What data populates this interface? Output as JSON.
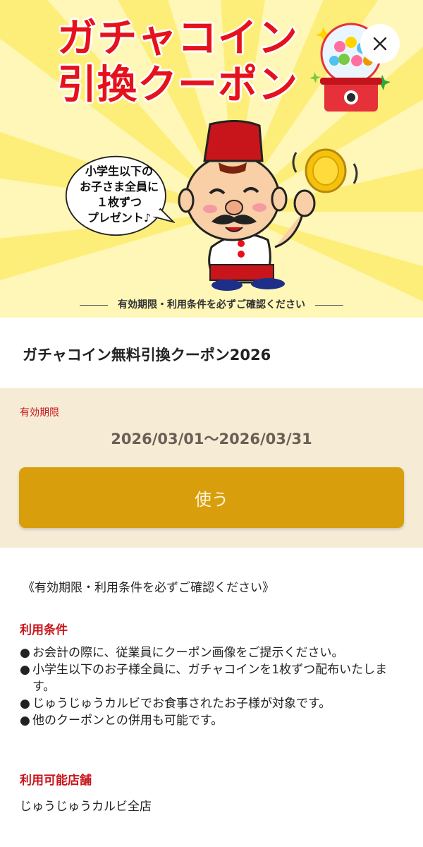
{
  "banner": {
    "title_line1": "ガチャコイン",
    "title_line2": "引換クーポン",
    "bubble_lines": [
      "小学生以下の",
      "お子さま全員に",
      "１枚ずつ",
      "プレゼント♪"
    ],
    "footer_text": "有効期限・利用条件を必ずご確認ください",
    "colors": {
      "title": "#e5121c",
      "background": "#fff7b8",
      "ray": "#fdee7a"
    }
  },
  "close_icon": "close-icon",
  "coupon": {
    "title": "ガチャコイン無料引換クーポン2026",
    "validity_label": "有効期限",
    "validity_value": "2026/03/01〜2026/03/31",
    "use_button_label": "使う",
    "colors": {
      "panel": "#f6ecd5",
      "button": "#d89e0b",
      "accent": "#c8151b"
    }
  },
  "details": {
    "notice": "《有効期限・利用条件を必ずご確認ください》",
    "conditions_heading": "利用条件",
    "conditions": [
      "お会計の際に、従業員にクーポン画像をご提示ください。",
      "小学生以下のお子様全員に、ガチャコインを1枚ずつ配布いたします。",
      "じゅうじゅうカルビでお食事されたお子様が対象です。",
      "他のクーポンとの併用も可能です。"
    ],
    "bullet": "●",
    "stores_heading": "利用可能店舗",
    "stores_text": "じゅうじゅうカルビ全店"
  }
}
